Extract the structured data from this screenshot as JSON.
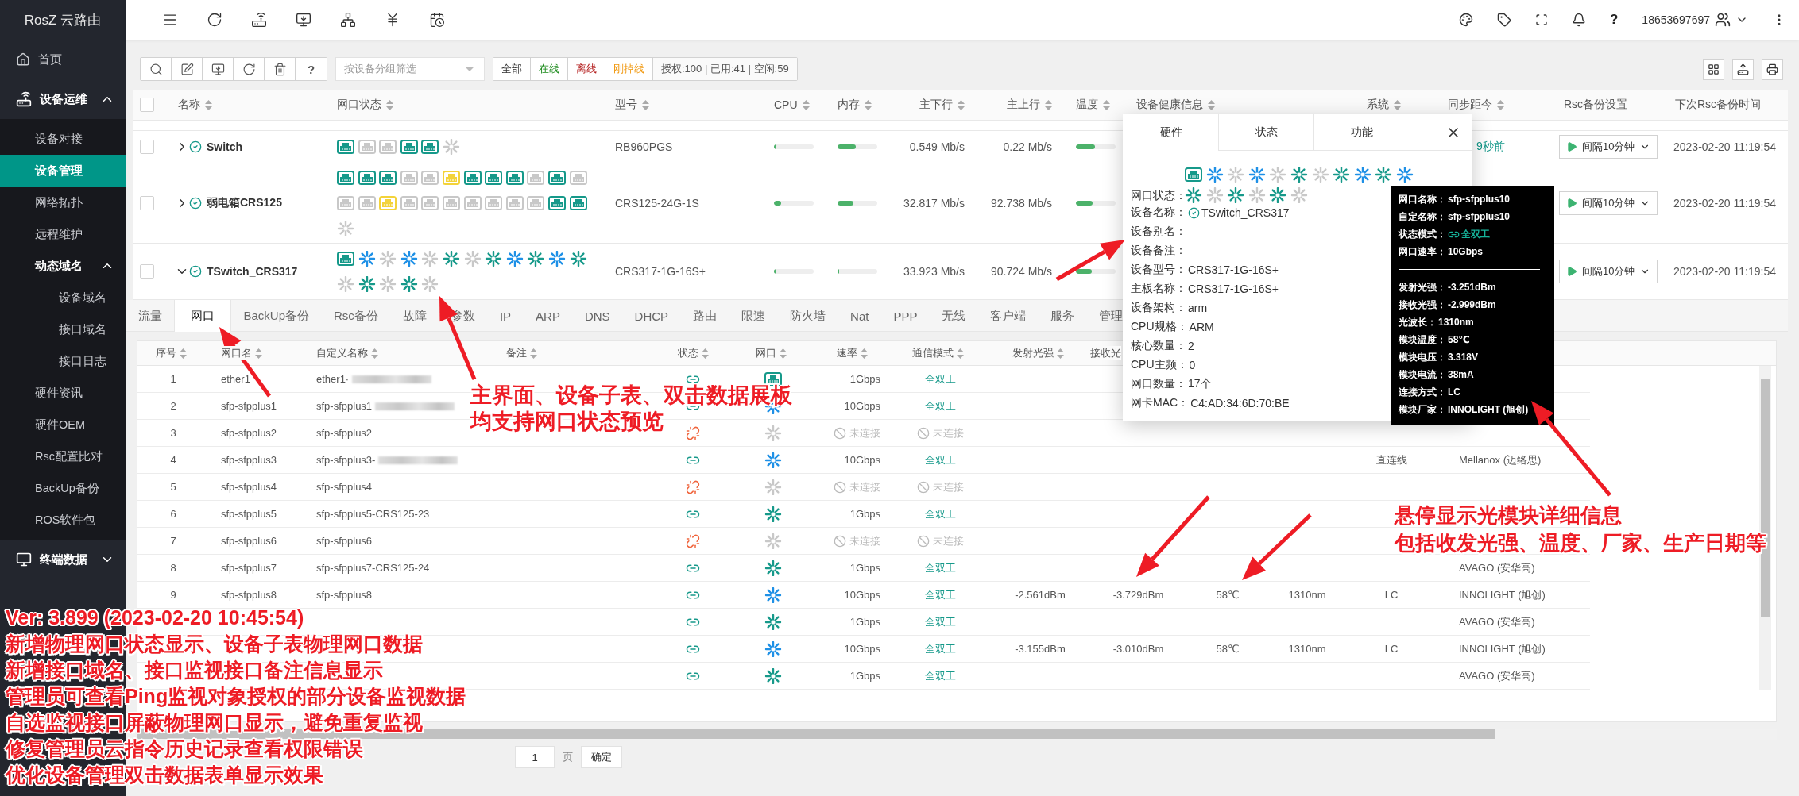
{
  "sidebar": {
    "brand": "RosZ 云路由",
    "items": [
      {
        "label": "首页",
        "selected": false
      },
      {
        "label": "设备运维",
        "selected": false,
        "expanded": true,
        "children": [
          {
            "label": "设备对接",
            "selected": false
          },
          {
            "label": "设备管理",
            "selected": true
          },
          {
            "label": "网络拓扑",
            "selected": false
          },
          {
            "label": "远程维护",
            "selected": false
          },
          {
            "label": "动态域名",
            "selected": false,
            "expanded": true,
            "children": [
              {
                "label": "设备域名",
                "selected": false
              },
              {
                "label": "接口域名",
                "selected": false
              },
              {
                "label": "接口日志",
                "selected": false
              }
            ]
          },
          {
            "label": "硬件资讯",
            "selected": false
          },
          {
            "label": "硬件OEM",
            "selected": false
          },
          {
            "label": "Rsc配置比对",
            "selected": false
          },
          {
            "label": "BackUp备份",
            "selected": false
          },
          {
            "label": "ROS软件包",
            "selected": false
          }
        ]
      },
      {
        "label": "终端数据",
        "selected": false,
        "expanded": false
      }
    ]
  },
  "topbar": {
    "help": "?",
    "user": "18653697697"
  },
  "toolbar": {
    "help": "?",
    "group_filter": {
      "placeholder": "按设备分组筛选"
    },
    "filters": [
      {
        "label": "全部",
        "kind": "all"
      },
      {
        "label": "在线",
        "kind": "online"
      },
      {
        "label": "离线",
        "kind": "offline"
      },
      {
        "label": "刚掉线",
        "kind": "dropped"
      }
    ],
    "license": "授权:100 | 已用:41 | 空闲:59"
  },
  "device_table": {
    "select_all": {
      "checked": false
    },
    "columns": [
      {
        "label": "名称",
        "sortable": true
      },
      {
        "label": "网口状态",
        "sortable": true
      },
      {
        "label": "型号",
        "sortable": true
      },
      {
        "label": "CPU",
        "sortable": true
      },
      {
        "label": "内存",
        "sortable": true
      },
      {
        "label": "主下行",
        "sortable": true
      },
      {
        "label": "主上行",
        "sortable": true
      },
      {
        "label": "温度",
        "sortable": true
      },
      {
        "label": "设备健康信息",
        "sortable": true
      },
      {
        "label": "系统",
        "sortable": true
      },
      {
        "label": "同步距今",
        "sortable": true
      },
      {
        "label": "Rsc备份设置",
        "sortable": false
      },
      {
        "label": "下次Rsc备份时间",
        "sortable": false
      }
    ],
    "rows": [
      {
        "checked": false,
        "expanded": false,
        "online": true,
        "name": "Switch",
        "ports": [
          {
            "kind": "rj45",
            "color": "#16998a"
          },
          {
            "kind": "rj45",
            "color": "#c8c8c8"
          },
          {
            "kind": "rj45",
            "color": "#c8c8c8"
          },
          {
            "kind": "rj45",
            "color": "#16998a"
          },
          {
            "kind": "rj45",
            "color": "#16998a"
          },
          {
            "kind": "sfp",
            "color": "#c8c8c8"
          }
        ],
        "model": "RB960PGS",
        "cpu": {
          "level": 0.05
        },
        "memory": {
          "level": 0.45
        },
        "download": "0.549 Mb/s",
        "upload": "0.22 Mb/s",
        "temperature": {
          "level": 0.47
        },
        "synced": "9秒前",
        "rsc_backup": "间隔10分钟",
        "next_backup": "2023-02-20 11:19:54"
      },
      {
        "checked": false,
        "expanded": false,
        "online": true,
        "name": "弱电箱CRS125",
        "ports": [
          {
            "kind": "rj45",
            "color": "#16998a"
          },
          {
            "kind": "rj45",
            "color": "#16998a"
          },
          {
            "kind": "rj45",
            "color": "#16998a"
          },
          {
            "kind": "rj45",
            "color": "#c8c8c8"
          },
          {
            "kind": "rj45",
            "color": "#c8c8c8"
          },
          {
            "kind": "rj45",
            "color": "#f3d33a"
          },
          {
            "kind": "rj45",
            "color": "#16998a"
          },
          {
            "kind": "rj45",
            "color": "#16998a"
          },
          {
            "kind": "rj45",
            "color": "#16998a"
          },
          {
            "kind": "rj45",
            "color": "#c8c8c8"
          },
          {
            "kind": "rj45",
            "color": "#16998a"
          },
          {
            "kind": "rj45",
            "color": "#c8c8c8"
          },
          {
            "kind": "rj45",
            "color": "#c8c8c8"
          },
          {
            "kind": "rj45",
            "color": "#c8c8c8"
          },
          {
            "kind": "rj45",
            "color": "#f3d33a"
          },
          {
            "kind": "rj45",
            "color": "#c8c8c8"
          },
          {
            "kind": "rj45",
            "color": "#c8c8c8"
          },
          {
            "kind": "rj45",
            "color": "#c8c8c8"
          },
          {
            "kind": "rj45",
            "color": "#c8c8c8"
          },
          {
            "kind": "rj45",
            "color": "#c8c8c8"
          },
          {
            "kind": "rj45",
            "color": "#c8c8c8"
          },
          {
            "kind": "rj45",
            "color": "#c8c8c8"
          },
          {
            "kind": "rj45",
            "color": "#16998a"
          },
          {
            "kind": "rj45",
            "color": "#16998a"
          },
          {
            "kind": "sfp",
            "color": "#c8c8c8"
          }
        ],
        "model": "CRS125-24G-1S",
        "cpu": {
          "level": 0.18
        },
        "memory": {
          "level": 0.39
        },
        "download": "32.817 Mb/s",
        "upload": "92.738 Mb/s",
        "temperature": {
          "level": 0.41
        },
        "rsc_backup": "间隔10分钟",
        "next_backup": "2023-02-20 11:19:54"
      },
      {
        "checked": false,
        "expanded": true,
        "online": true,
        "name": "TSwitch_CRS317",
        "ports": [
          {
            "kind": "rj45",
            "color": "#16998a"
          },
          {
            "kind": "sfp",
            "color": "#1e90e6"
          },
          {
            "kind": "sfp",
            "color": "#c8c8c8"
          },
          {
            "kind": "sfp",
            "color": "#1e90e6"
          },
          {
            "kind": "sfp",
            "color": "#c8c8c8"
          },
          {
            "kind": "sfp",
            "color": "#16998a"
          },
          {
            "kind": "sfp",
            "color": "#c8c8c8"
          },
          {
            "kind": "sfp",
            "color": "#16998a"
          },
          {
            "kind": "sfp",
            "color": "#1e90e6"
          },
          {
            "kind": "sfp",
            "color": "#16998a"
          },
          {
            "kind": "sfp",
            "color": "#1e90e6"
          },
          {
            "kind": "sfp",
            "color": "#16998a"
          },
          {
            "kind": "sfp",
            "color": "#c8c8c8"
          },
          {
            "kind": "sfp",
            "color": "#16998a"
          },
          {
            "kind": "sfp",
            "color": "#c8c8c8"
          },
          {
            "kind": "sfp",
            "color": "#16998a"
          },
          {
            "kind": "sfp",
            "color": "#c8c8c8"
          }
        ],
        "model": "CRS317-1G-16S+",
        "cpu": {
          "level": 0.04
        },
        "memory": {
          "level": 0.04
        },
        "download": "33.923 Mb/s",
        "upload": "90.724 Mb/s",
        "temperature": {
          "level": 0.4
        },
        "rsc_backup": "间隔10分钟",
        "next_backup": "2023-02-20 11:19:54"
      }
    ]
  },
  "detail": {
    "tabs": [
      {
        "label": "流量",
        "selected": false
      },
      {
        "label": "网口",
        "selected": true
      },
      {
        "label": "BackUp备份",
        "selected": false
      },
      {
        "label": "Rsc备份",
        "selected": false
      },
      {
        "label": "故障",
        "selected": false
      },
      {
        "label": "参数",
        "selected": false
      },
      {
        "label": "IP",
        "selected": false
      },
      {
        "label": "ARP",
        "selected": false
      },
      {
        "label": "DNS",
        "selected": false
      },
      {
        "label": "DHCP",
        "selected": false
      },
      {
        "label": "路由",
        "selected": false
      },
      {
        "label": "限速",
        "selected": false
      },
      {
        "label": "防火墙",
        "selected": false
      },
      {
        "label": "Nat",
        "selected": false
      },
      {
        "label": "PPP",
        "selected": false
      },
      {
        "label": "无线",
        "selected": false
      },
      {
        "label": "客户端",
        "selected": false
      },
      {
        "label": "服务",
        "selected": false
      },
      {
        "label": "管理",
        "selected": false
      }
    ],
    "ports_table": {
      "columns": [
        {
          "label": "序号",
          "sortable": true
        },
        {
          "label": "网口名",
          "sortable": true
        },
        {
          "label": "自定义名称",
          "sortable": true
        },
        {
          "label": "备注",
          "sortable": true
        },
        {
          "label": "状态",
          "sortable": true
        },
        {
          "label": "网口",
          "sortable": true
        },
        {
          "label": "速率",
          "sortable": true
        },
        {
          "label": "通信模式",
          "sortable": true
        },
        {
          "label": "发射光强",
          "sortable": true
        },
        {
          "label": "接收光",
          "sortable": false
        }
      ],
      "rows": [
        {
          "index": "1",
          "name": "ether1",
          "custom_name": "ether1·",
          "redacted": true,
          "linked": true,
          "port": {
            "kind": "rj45",
            "color": "#16998a"
          },
          "speed": "1Gbps",
          "duplex": "全双工"
        },
        {
          "index": "2",
          "name": "sfp-sfpplus1",
          "custom_name": "sfp-sfpplus1",
          "redacted": true,
          "linked": true,
          "port": {
            "kind": "sfp",
            "color": "#1e90e6"
          },
          "speed": "10Gbps",
          "duplex": "全双工"
        },
        {
          "index": "3",
          "name": "sfp-sfpplus2",
          "custom_name": "sfp-sfpplus2",
          "linked": false,
          "port": {
            "kind": "sfp",
            "color": "#c8c8c8"
          },
          "speed": "未连接",
          "duplex": "未连接"
        },
        {
          "index": "4",
          "name": "sfp-sfpplus3",
          "custom_name": "sfp-sfpplus3-",
          "redacted": true,
          "linked": true,
          "port": {
            "kind": "sfp",
            "color": "#1e90e6"
          },
          "speed": "10Gbps",
          "duplex": "全双工",
          "connector": "直连线",
          "vendor": "Mellanox (迈络思)"
        },
        {
          "index": "5",
          "name": "sfp-sfpplus4",
          "custom_name": "sfp-sfpplus4",
          "linked": false,
          "port": {
            "kind": "sfp",
            "color": "#c8c8c8"
          },
          "speed": "未连接",
          "duplex": "未连接"
        },
        {
          "index": "6",
          "name": "sfp-sfpplus5",
          "custom_name": "sfp-sfpplus5-CRS125-23",
          "linked": true,
          "port": {
            "kind": "sfp",
            "color": "#16998a"
          },
          "speed": "1Gbps",
          "duplex": "全双工"
        },
        {
          "index": "7",
          "name": "sfp-sfpplus6",
          "custom_name": "sfp-sfpplus6",
          "linked": false,
          "port": {
            "kind": "sfp",
            "color": "#c8c8c8"
          },
          "speed": "未连接",
          "duplex": "未连接"
        },
        {
          "index": "8",
          "name": "sfp-sfpplus7",
          "custom_name": "sfp-sfpplus7-CRS125-24",
          "linked": true,
          "port": {
            "kind": "sfp",
            "color": "#16998a"
          },
          "speed": "1Gbps",
          "duplex": "全双工",
          "vendor": "AVAGO (安华高)"
        },
        {
          "index": "9",
          "name": "sfp-sfpplus8",
          "custom_name": "sfp-sfpplus8",
          "linked": true,
          "port": {
            "kind": "sfp",
            "color": "#1e90e6"
          },
          "speed": "10Gbps",
          "duplex": "全双工",
          "tx": "-2.561dBm",
          "rx": "-3.729dBm",
          "temp": "58℃",
          "wavelength": "1310nm",
          "connector": "LC",
          "vendor": "INNOLIGHT (旭创)"
        },
        {
          "linked": true,
          "port": {
            "kind": "sfp",
            "color": "#16998a"
          },
          "speed": "1Gbps",
          "duplex": "全双工",
          "vendor": "AVAGO (安华高)"
        },
        {
          "linked": true,
          "port": {
            "kind": "sfp",
            "color": "#1e90e6"
          },
          "speed": "10Gbps",
          "duplex": "全双工",
          "tx": "-3.155dBm",
          "rx": "-3.010dBm",
          "temp": "58℃",
          "wavelength": "1310nm",
          "connector": "LC",
          "vendor": "INNOLIGHT (旭创)"
        },
        {
          "linked": true,
          "port": {
            "kind": "sfp",
            "color": "#16998a"
          },
          "speed": "1Gbps",
          "duplex": "全双工",
          "vendor": "AVAGO (安华高)"
        }
      ]
    },
    "pagination": {
      "jump_value": "1",
      "page_unit": "页",
      "confirm": "确定"
    }
  },
  "device_popup": {
    "tabs": [
      {
        "label": "硬件",
        "selected": true
      },
      {
        "label": "状态",
        "selected": false
      },
      {
        "label": "功能",
        "selected": false
      }
    ],
    "ports": [
      {
        "kind": "rj45",
        "color": "#16998a"
      },
      {
        "kind": "sfp",
        "color": "#1e90e6"
      },
      {
        "kind": "sfp",
        "color": "#c8c8c8"
      },
      {
        "kind": "sfp",
        "color": "#1e90e6"
      },
      {
        "kind": "sfp",
        "color": "#c8c8c8"
      },
      {
        "kind": "sfp",
        "color": "#16998a"
      },
      {
        "kind": "sfp",
        "color": "#c8c8c8"
      },
      {
        "kind": "sfp",
        "color": "#16998a"
      },
      {
        "kind": "sfp",
        "color": "#1e90e6"
      },
      {
        "kind": "sfp",
        "color": "#16998a"
      },
      {
        "kind": "sfp",
        "color": "#1e90e6"
      },
      {
        "kind": "sfp",
        "color": "#16998a"
      },
      {
        "kind": "sfp",
        "color": "#c8c8c8"
      },
      {
        "kind": "sfp",
        "color": "#16998a"
      },
      {
        "kind": "sfp",
        "color": "#c8c8c8"
      },
      {
        "kind": "sfp",
        "color": "#16998a"
      },
      {
        "kind": "sfp",
        "color": "#c8c8c8"
      }
    ],
    "fields": [
      {
        "label": "网口状态：",
        "kind": "ports"
      },
      {
        "label": "设备名称：",
        "kind": "device",
        "value": "TSwitch_CRS317"
      },
      {
        "label": "设备别名：",
        "kind": "text"
      },
      {
        "label": "设备备注：",
        "kind": "text"
      },
      {
        "label": "设备型号：",
        "kind": "text",
        "value": "CRS317-1G-16S+"
      },
      {
        "label": "主板名称：",
        "kind": "text",
        "value": "CRS317-1G-16S+"
      },
      {
        "label": "设备架构：",
        "kind": "text",
        "value": "arm"
      },
      {
        "label": "CPU规格：",
        "kind": "text",
        "value": "ARM"
      },
      {
        "label": "核心数量：",
        "kind": "text",
        "value": "2"
      },
      {
        "label": "CPU主频：",
        "kind": "text",
        "value": "0"
      },
      {
        "label": "网口数量：",
        "kind": "text",
        "value": "17个"
      },
      {
        "label": "网卡MAC：",
        "kind": "text",
        "value": "C4:AD:34:6D:70:BE"
      }
    ]
  },
  "port_tooltip": {
    "groups": [
      [
        {
          "label": "网口名称：",
          "value": "sfp-sfpplus10",
          "kind": "text"
        },
        {
          "label": "自定名称：",
          "value": "sfp-sfpplus10",
          "kind": "text"
        },
        {
          "label": "状态模式：",
          "value": "全双工",
          "kind": "link"
        },
        {
          "label": "网口速率：",
          "value": "10Gbps",
          "kind": "text"
        }
      ],
      [
        {
          "label": "发射光强：",
          "value": "-3.251dBm",
          "kind": "text"
        },
        {
          "label": "接收光强：",
          "value": "-2.999dBm",
          "kind": "text"
        },
        {
          "label": "光波长：",
          "value": "1310nm",
          "kind": "text"
        },
        {
          "label": "模块温度：",
          "value": "58℃",
          "kind": "text"
        },
        {
          "label": "模块电压：",
          "value": "3.318V",
          "kind": "text"
        },
        {
          "label": "模块电流：",
          "value": "38mA",
          "kind": "text"
        },
        {
          "label": "连接方式：",
          "value": "LC",
          "kind": "text"
        },
        {
          "label": "模块厂家：",
          "value": "INNOLIGHT (旭创)",
          "kind": "text"
        }
      ]
    ]
  },
  "annotations": [
    {
      "lines": [
        "主界面、设备子表、双击数据展板",
        "均支持网口状态预览"
      ]
    },
    {
      "lines": [
        "悬停显示光模块详细信息",
        "包括收发光强、温度、厂家、生产日期等"
      ]
    },
    {
      "lines": [
        "Ver: 3.899 (2023-02-20 10:45:54)",
        "新增物理网口状态显示、设备子表物理网口数据",
        "新增接口域名、接口监视接口备注信息显示",
        "管理员可查看Ping监视对象授权的部分设备监视数据",
        "自选监视接口屏蔽物理网口显示，避免重复监视",
        "修复管理员云指令历史记录查看权限错误",
        "优化设备管理双击数据表单显示效果"
      ]
    }
  ]
}
